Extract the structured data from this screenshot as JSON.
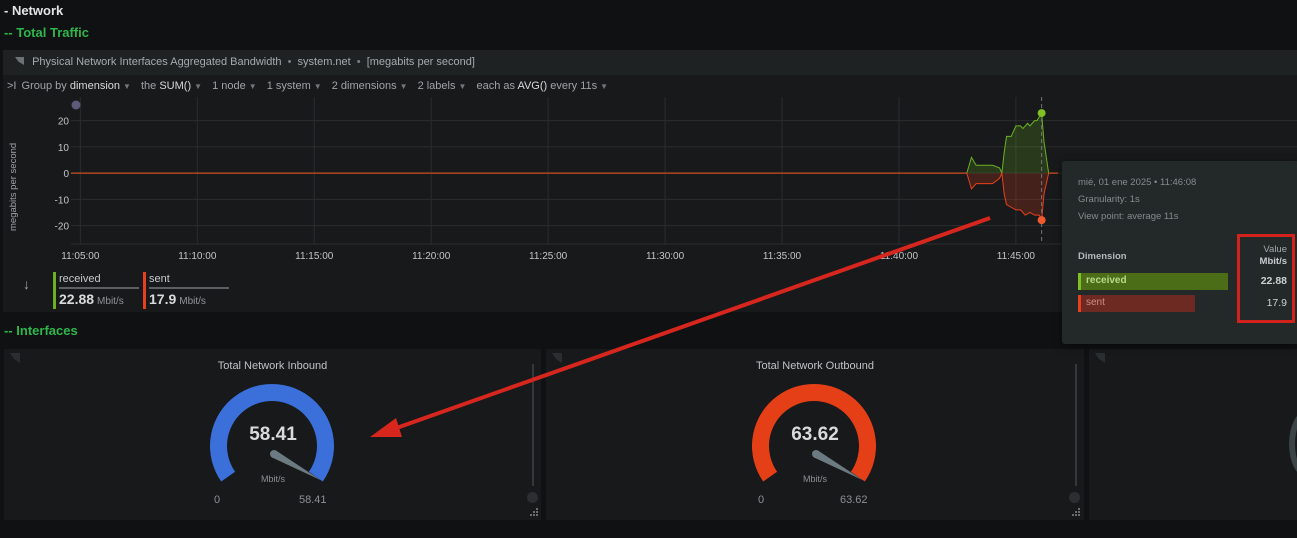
{
  "section": {
    "title": "- Network",
    "subsections": [
      "-- Total Traffic",
      "-- Interfaces"
    ]
  },
  "chart_panel": {
    "title": "Physical Network Interfaces Aggregated Bandwidth",
    "context": "system.net",
    "units": "[megabits per second]",
    "toolbar": {
      "group_prefix": "Group by",
      "group_value": "dimension",
      "agg_prefix": "the",
      "agg_value": "SUM()",
      "nodes": "1 node",
      "systems": "1 system",
      "dimensions": "2 dimensions",
      "labels": "2 labels",
      "time_prefix": "each as",
      "time_value": "AVG()",
      "time_suffix": "every 11s"
    },
    "legend": {
      "items": [
        {
          "name": "received",
          "value": "22.88",
          "unit": "Mbit/s",
          "color": "#6bb120"
        },
        {
          "name": "sent",
          "value": "17.9",
          "unit": "Mbit/s",
          "color": "#e8401d"
        }
      ]
    }
  },
  "tooltip": {
    "datetime": "mié, 01 ene 2025 • 11:46:08",
    "granularity": "Granularity: 1s",
    "view_point": "View point: average 11s",
    "dimension_header": "Dimension",
    "value_header": "Value",
    "unit_header": "Mbit/s",
    "rows": [
      {
        "name": "received",
        "value": "22.88"
      },
      {
        "name": "sent",
        "value": "17.9"
      }
    ]
  },
  "gauges": [
    {
      "title": "Total Network Inbound",
      "value": "58.41",
      "unit": "Mbit/s",
      "min": "0",
      "max": "58.41",
      "fraction": 1.0,
      "color": "#3b6fd9"
    },
    {
      "title": "Total Network Outbound",
      "value": "63.62",
      "unit": "Mbit/s",
      "min": "0",
      "max": "63.62",
      "fraction": 1.0,
      "color": "#e53f18"
    }
  ],
  "chart_data": {
    "type": "area",
    "title": "Physical Network Interfaces Aggregated Bandwidth",
    "ylabel": "megabits per second",
    "xlabel": "",
    "ylim": [
      -27,
      29
    ],
    "yticks": [
      20,
      10,
      0,
      -10,
      -20
    ],
    "xticks": [
      "11:05:00",
      "11:10:00",
      "11:15:00",
      "11:20:00",
      "11:25:00",
      "11:30:00",
      "11:35:00",
      "11:40:00",
      "11:45:00"
    ],
    "x_range_minutes": [
      4.6,
      46.8
    ],
    "grid": true,
    "highlight_time": "11:46:08",
    "series": [
      {
        "name": "received",
        "color": "#6bb120",
        "points": [
          [
            4.6,
            0
          ],
          [
            42.9,
            0
          ],
          [
            43.0,
            3
          ],
          [
            43.1,
            6
          ],
          [
            43.3,
            3
          ],
          [
            43.6,
            3
          ],
          [
            44.0,
            3
          ],
          [
            44.3,
            2
          ],
          [
            44.4,
            0
          ],
          [
            44.5,
            8
          ],
          [
            44.6,
            14
          ],
          [
            44.8,
            14
          ],
          [
            45.0,
            18
          ],
          [
            45.2,
            18
          ],
          [
            45.3,
            17
          ],
          [
            45.5,
            19
          ],
          [
            45.6,
            18
          ],
          [
            45.8,
            20
          ],
          [
            45.9,
            20
          ],
          [
            46.1,
            22.88
          ],
          [
            46.2,
            12
          ],
          [
            46.4,
            0
          ],
          [
            46.8,
            0
          ]
        ]
      },
      {
        "name": "sent",
        "color": "#e8401d",
        "points": [
          [
            4.6,
            0
          ],
          [
            42.9,
            0
          ],
          [
            43.0,
            -3
          ],
          [
            43.1,
            -6
          ],
          [
            43.3,
            -4
          ],
          [
            43.6,
            -4
          ],
          [
            44.0,
            -4
          ],
          [
            44.3,
            -2
          ],
          [
            44.4,
            0
          ],
          [
            44.5,
            -8
          ],
          [
            44.6,
            -12
          ],
          [
            44.8,
            -13
          ],
          [
            45.0,
            -14
          ],
          [
            45.2,
            -14
          ],
          [
            45.4,
            -16
          ],
          [
            45.6,
            -15
          ],
          [
            45.8,
            -16
          ],
          [
            46.0,
            -16
          ],
          [
            46.1,
            -17.9
          ],
          [
            46.2,
            -8
          ],
          [
            46.4,
            0
          ],
          [
            46.8,
            0
          ]
        ]
      }
    ]
  }
}
